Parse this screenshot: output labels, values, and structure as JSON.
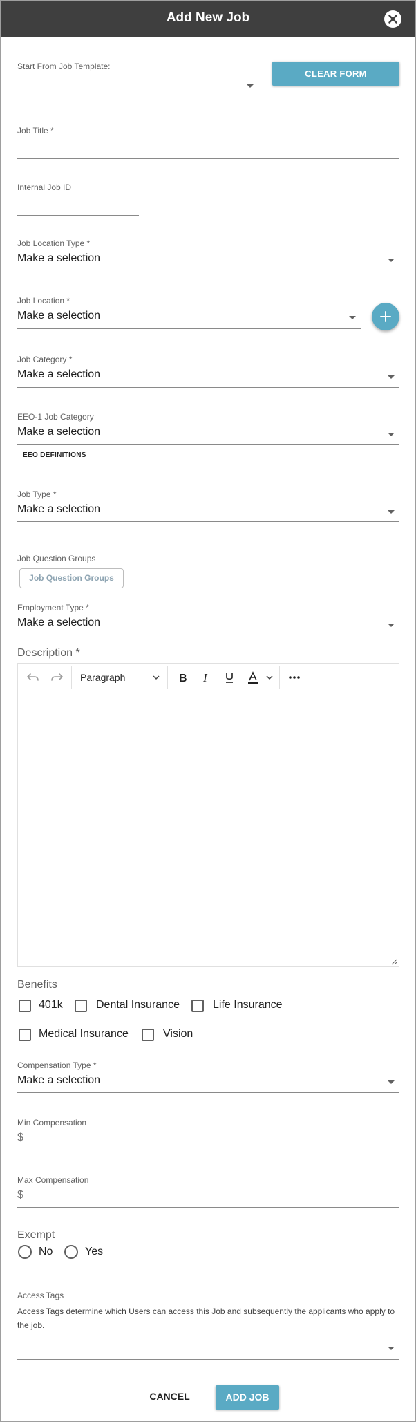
{
  "dialog": {
    "title": "Add New Job",
    "close_icon": "close-icon"
  },
  "template": {
    "label": "Start From Job Template:",
    "value": "",
    "clear_label": "CLEAR FORM"
  },
  "job_title": {
    "label": "Job Title *",
    "value": ""
  },
  "internal_job_id": {
    "label": "Internal Job ID",
    "value": ""
  },
  "job_location_type": {
    "label": "Job Location Type *",
    "value": "Make a selection"
  },
  "job_location": {
    "label": "Job Location *",
    "value": "Make a selection",
    "add_icon": "plus-icon"
  },
  "job_category": {
    "label": "Job Category *",
    "value": "Make a selection"
  },
  "eeo_category": {
    "label": "EEO-1 Job Category",
    "value": "Make a selection",
    "link_label": "EEO DEFINITIONS"
  },
  "job_type": {
    "label": "Job Type *",
    "value": "Make a selection"
  },
  "question_groups": {
    "label": "Job Question Groups",
    "button_label": "Job Question Groups"
  },
  "employment_type": {
    "label": "Employment Type *",
    "value": "Make a selection"
  },
  "description": {
    "label": "Description *",
    "block_format": "Paragraph",
    "toolbar_icons": [
      "undo-icon",
      "redo-icon",
      "bold-icon",
      "italic-icon",
      "underline-icon",
      "text-color-icon",
      "more-icon"
    ]
  },
  "benefits": {
    "label": "Benefits",
    "options": [
      {
        "label": "401k",
        "checked": false
      },
      {
        "label": "Dental Insurance",
        "checked": false
      },
      {
        "label": "Life Insurance",
        "checked": false
      },
      {
        "label": "Medical Insurance",
        "checked": false
      },
      {
        "label": "Vision",
        "checked": false
      }
    ]
  },
  "compensation_type": {
    "label": "Compensation Type *",
    "value": "Make a selection"
  },
  "min_compensation": {
    "label": "Min Compensation",
    "prefix": "$",
    "value": ""
  },
  "max_compensation": {
    "label": "Max Compensation",
    "prefix": "$",
    "value": ""
  },
  "exempt": {
    "label": "Exempt",
    "options": [
      {
        "label": "No",
        "selected": false
      },
      {
        "label": "Yes",
        "selected": false
      }
    ]
  },
  "access_tags": {
    "label": "Access Tags",
    "description": "Access Tags determine which Users can access this Job and subsequently the applicants who apply to the job.",
    "value": ""
  },
  "footer": {
    "cancel_label": "CANCEL",
    "add_label": "ADD JOB"
  },
  "colors": {
    "header": "#3f3f3f",
    "accent": "#5aaac4"
  }
}
